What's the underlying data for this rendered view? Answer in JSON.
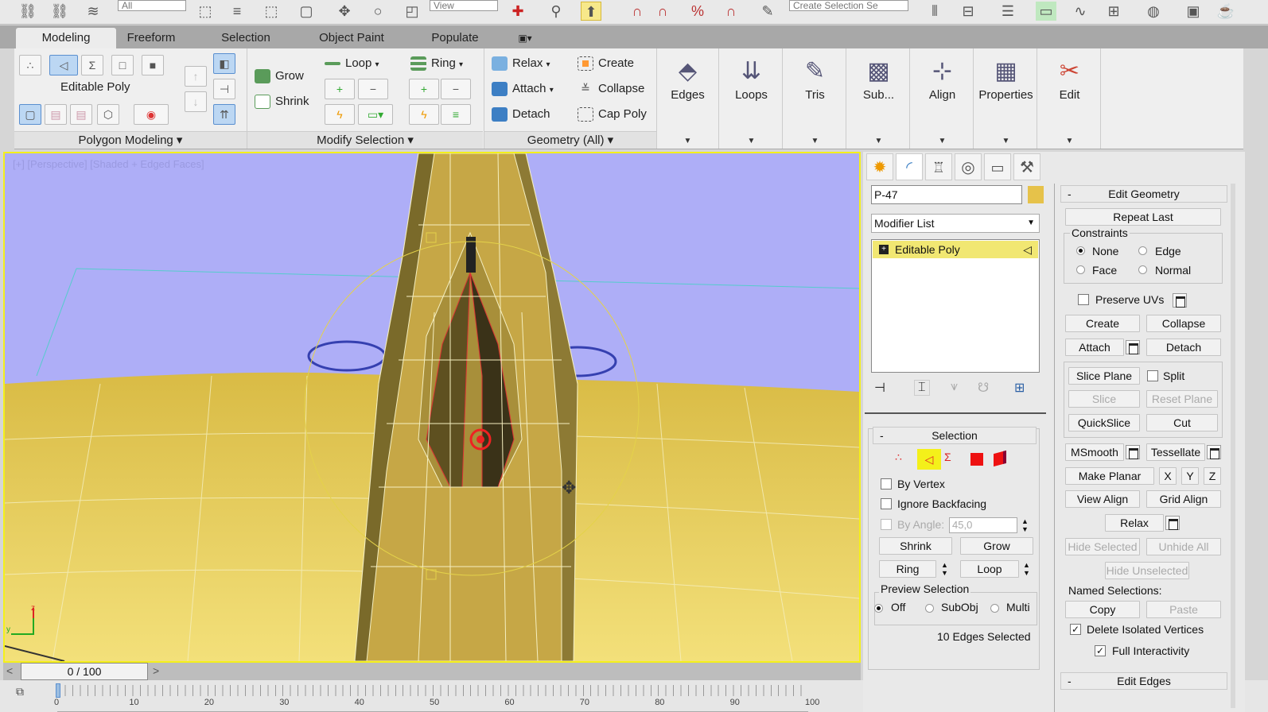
{
  "toolbar": {
    "selection_filter": "All",
    "coord_system": "View",
    "named_selection_placeholder": "Create Selection Se",
    "icons": [
      "link-icon",
      "unlink-icon",
      "bind-space-warp-icon",
      "select-object-icon",
      "select-by-name-icon",
      "rect-region-icon",
      "window-crossing-icon",
      "move-icon",
      "rotate-icon",
      "scale-icon",
      "pivot-icon",
      "select-manipulate-icon",
      "keyboard-shortcut-icon",
      "snap-icon",
      "angle-snap-icon",
      "percent-snap-icon",
      "spinner-snap-icon",
      "edit-named-selection-icon",
      "mirror-icon",
      "align-icon",
      "layer-explorer-icon",
      "graphite-toggle-icon",
      "curve-editor-icon",
      "schematic-view-icon",
      "material-editor-icon",
      "render-setup-icon",
      "rendered-frame-icon",
      "render-icon"
    ]
  },
  "ribbon": {
    "tabs": [
      "Modeling",
      "Freeform",
      "Selection",
      "Object Paint",
      "Populate"
    ],
    "active_tab": "Modeling",
    "polygon_modeling": {
      "label": "Polygon Modeling",
      "object": "Editable Poly"
    },
    "modify_selection": {
      "label": "Modify Selection",
      "grow": "Grow",
      "shrink": "Shrink",
      "loop": "Loop",
      "ring": "Ring"
    },
    "geometry": {
      "label": "Geometry (All)",
      "relax": "Relax",
      "attach": "Attach",
      "detach": "Detach",
      "create": "Create",
      "collapse": "Collapse",
      "cap_poly": "Cap Poly"
    },
    "big_buttons": [
      "Edges",
      "Loops",
      "Tris",
      "Sub...",
      "Align",
      "Properties",
      "Edit"
    ]
  },
  "viewport": {
    "label": "[+] [Perspective] [Shaded + Edged Faces]",
    "sky_color": "#aeaef7",
    "ground_color": "#e8c94e",
    "highlight_color": "#f4f01a"
  },
  "time_slider": {
    "value": "0 / 100",
    "prev": "<",
    "next": ">",
    "current_frame": 0,
    "total_frames": 100
  },
  "timeline": {
    "ticks": [
      "0",
      "10",
      "20",
      "30",
      "40",
      "50",
      "60",
      "70",
      "80",
      "90",
      "100"
    ]
  },
  "command_panel": {
    "object_name": "P-47",
    "object_color": "#e6c24a",
    "modifier_list": "Modifier List",
    "stack_item": "Editable Poly",
    "selection": {
      "title": "Selection",
      "by_vertex": "By Vertex",
      "ignore_backfacing": "Ignore Backfacing",
      "by_angle": "By Angle:",
      "angle_value": "45,0",
      "shrink": "Shrink",
      "grow": "Grow",
      "ring": "Ring",
      "loop": "Loop",
      "preview_title": "Preview Selection",
      "preview_options": [
        "Off",
        "SubObj",
        "Multi"
      ],
      "preview_selected": "Off",
      "status": "10 Edges Selected"
    },
    "edit_geometry": {
      "title": "Edit Geometry",
      "repeat_last": "Repeat Last",
      "constraints_title": "Constraints",
      "constraints": [
        "None",
        "Edge",
        "Face",
        "Normal"
      ],
      "constraint_selected": "None",
      "preserve_uvs": "Preserve UVs",
      "create": "Create",
      "collapse": "Collapse",
      "attach": "Attach",
      "detach": "Detach",
      "slice_plane": "Slice Plane",
      "split": "Split",
      "slice": "Slice",
      "reset_plane": "Reset Plane",
      "quickslice": "QuickSlice",
      "cut": "Cut",
      "msmooth": "MSmooth",
      "tessellate": "Tessellate",
      "make_planar": "Make Planar",
      "x": "X",
      "y": "Y",
      "z": "Z",
      "view_align": "View Align",
      "grid_align": "Grid Align",
      "relax": "Relax",
      "hide_selected": "Hide Selected",
      "unhide_all": "Unhide All",
      "hide_unselected": "Hide Unselected",
      "named_selections": "Named Selections:",
      "copy": "Copy",
      "paste": "Paste",
      "delete_isolated": "Delete Isolated Vertices",
      "full_interactivity": "Full Interactivity"
    },
    "edit_edges": {
      "title": "Edit Edges"
    }
  }
}
